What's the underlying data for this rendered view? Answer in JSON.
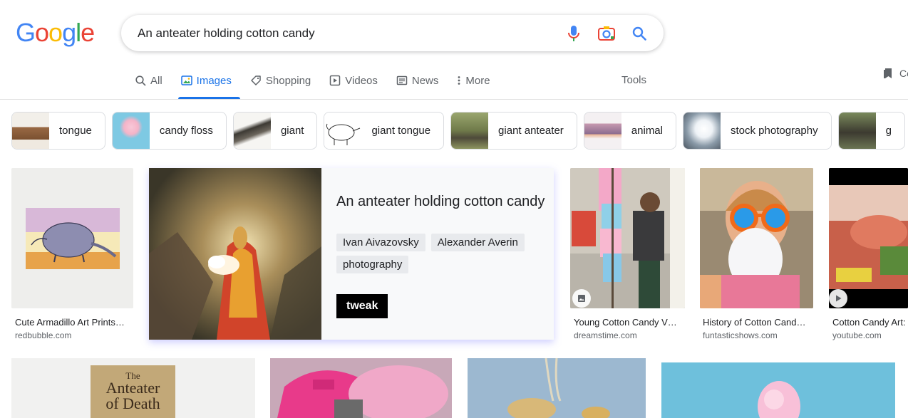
{
  "logo": {
    "letters": [
      "G",
      "o",
      "o",
      "g",
      "l",
      "e"
    ],
    "colors": [
      "#4285f4",
      "#ea4335",
      "#fbbc05",
      "#4285f4",
      "#34a853",
      "#ea4335"
    ]
  },
  "search": {
    "query": "An anteater holding cotton candy"
  },
  "tabs": [
    {
      "label": "All",
      "icon": "search-icon"
    },
    {
      "label": "Images",
      "icon": "image-icon"
    },
    {
      "label": "Shopping",
      "icon": "tag-icon"
    },
    {
      "label": "Videos",
      "icon": "play-icon"
    },
    {
      "label": "News",
      "icon": "newspaper-icon"
    },
    {
      "label": "More",
      "icon": "more-vertical-icon"
    }
  ],
  "tools_label": "Tools",
  "collections_label": "Co",
  "chips": [
    {
      "label": "tongue",
      "thumb_color": "#b98a63"
    },
    {
      "label": "candy floss",
      "thumb_color": "#7ec9e3"
    },
    {
      "label": "giant",
      "thumb_color": "#d9d7d0"
    },
    {
      "label": "giant tongue",
      "thumb_color": "#f4f4f4"
    },
    {
      "label": "giant anteater",
      "thumb_color": "#7b8a5a"
    },
    {
      "label": "animal",
      "thumb_color": "#d0a8b8"
    },
    {
      "label": "stock photography",
      "thumb_color": "#c8d0d8"
    },
    {
      "label": "g",
      "thumb_color": "#5c6a4a"
    }
  ],
  "results": [
    {
      "title": "Cute Armadillo Art Prints…",
      "site": "redbubble.com"
    },
    {
      "title": "Young Cotton Candy V…",
      "site": "dreamstime.com"
    },
    {
      "title": "History of Cotton Cand…",
      "site": "funtasticshows.com"
    },
    {
      "title": "Cotton Candy Art:",
      "site": "youtube.com"
    }
  ],
  "feature": {
    "title": "An anteater holding cotton candy",
    "tags": [
      "Ivan Aivazovsky",
      "Alexander Averin",
      "photography"
    ],
    "tweak_label": "tweak"
  },
  "row2_book_title": [
    "The",
    "Anteater",
    "of Death"
  ]
}
